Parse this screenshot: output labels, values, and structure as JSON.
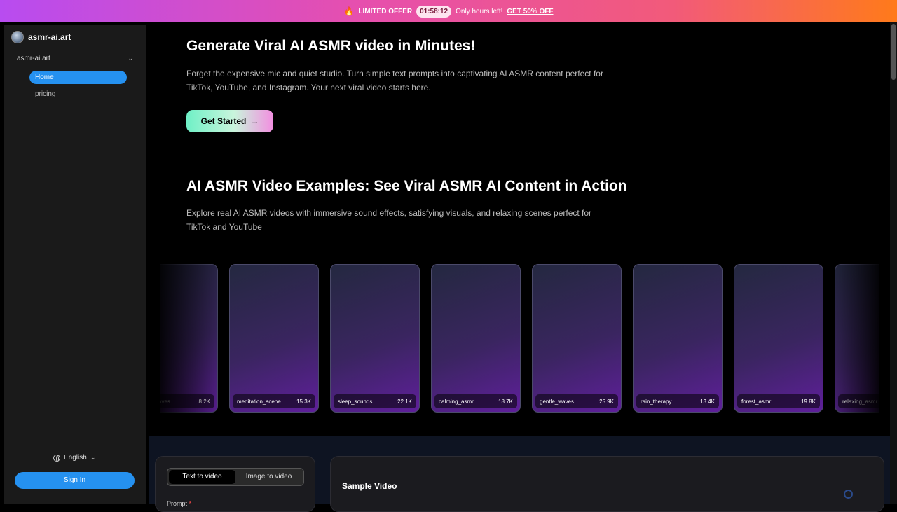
{
  "promo": {
    "flame_icon": "fire-icon",
    "label": "LIMITED OFFER",
    "timer": "01:58:12",
    "text": "Only hours left!",
    "cta": "GET 50% OFF"
  },
  "sidebar": {
    "brand": "asmr-ai.art",
    "group": "asmr-ai.art",
    "items": [
      {
        "label": "Home"
      },
      {
        "label": "pricing"
      }
    ],
    "language": "English",
    "signin": "Sign In"
  },
  "hero": {
    "title": "Generate Viral AI ASMR video in Minutes!",
    "subtitle": "Forget the expensive mic and quiet studio. Turn simple text prompts into captivating AI ASMR content perfect for TikTok, YouTube, and Instagram. Your next viral video starts here.",
    "cta": "Get Started",
    "cta_arrow": "→"
  },
  "examples": {
    "title": "AI ASMR Video Examples: See Viral ASMR AI Content in Action",
    "subtitle": "Explore real AI ASMR videos with immersive sound effects, satisfying visuals, and relaxing scenes perfect for TikTok and YouTube",
    "cards": [
      {
        "name": "ocean_waves",
        "views": "8.2K"
      },
      {
        "name": "meditation_scene",
        "views": "15.3K"
      },
      {
        "name": "sleep_sounds",
        "views": "22.1K"
      },
      {
        "name": "calming_asmr",
        "views": "18.7K"
      },
      {
        "name": "gentle_waves",
        "views": "25.9K"
      },
      {
        "name": "rain_therapy",
        "views": "13.4K"
      },
      {
        "name": "forest_asmr",
        "views": "19.8K"
      },
      {
        "name": "relaxing_asmr",
        "views": ""
      }
    ]
  },
  "generator": {
    "tabs": [
      "Text to video",
      "Image to video"
    ],
    "prompt_label": "Prompt",
    "required_mark": "*",
    "sample_title": "Sample Video"
  }
}
